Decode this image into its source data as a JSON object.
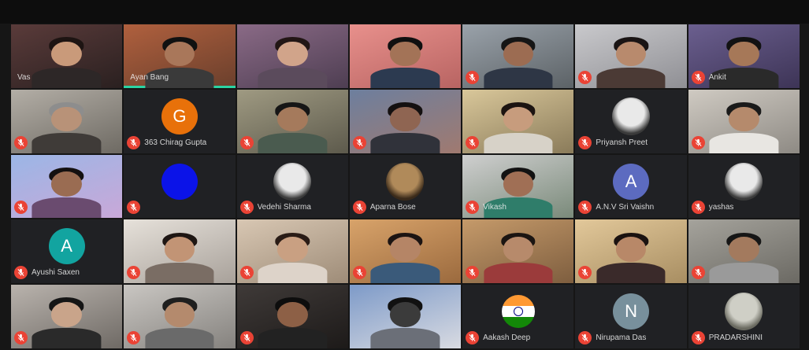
{
  "meeting": {
    "colors": {
      "background": "#161616",
      "tile": "#202124",
      "mic_muted": "#ea4335",
      "speaking": "#2bd3a3"
    },
    "participants": [
      {
        "name": "Vas",
        "type": "video",
        "muted": false,
        "speaking": false,
        "bg1": "#5a3b3a",
        "bg2": "#2a2020",
        "skin": "#c99a7a",
        "hair": "#1d1412",
        "shirt": "#2d2727"
      },
      {
        "name": "Ayan Bang",
        "type": "video",
        "muted": false,
        "speaking": true,
        "bg1": "#b0603e",
        "bg2": "#6a3f2c",
        "skin": "#a9775a",
        "hair": "#111",
        "shirt": "#3a3a3a"
      },
      {
        "name": "",
        "type": "video",
        "muted": false,
        "speaking": false,
        "bg1": "#8a6a86",
        "bg2": "#4e3e52",
        "skin": "#d1a48a",
        "hair": "#221615",
        "shirt": "#5b4b5c"
      },
      {
        "name": "",
        "type": "video",
        "muted": false,
        "speaking": false,
        "bg1": "#e8908c",
        "bg2": "#b86462",
        "skin": "#a37357",
        "hair": "#101010",
        "shirt": "#2c3a50"
      },
      {
        "name": "",
        "type": "video",
        "muted": true,
        "speaking": false,
        "bg1": "#9aa2aa",
        "bg2": "#5c6266",
        "skin": "#9c6c52",
        "hair": "#151515",
        "shirt": "#2e3645"
      },
      {
        "name": "",
        "type": "video",
        "muted": true,
        "speaking": false,
        "bg1": "#c9c9cc",
        "bg2": "#8f8f94",
        "skin": "#b88a6d",
        "hair": "#1a1414",
        "shirt": "#4b3a35"
      },
      {
        "name": "Ankit",
        "type": "video",
        "muted": true,
        "speaking": false,
        "bg1": "#6b5f8f",
        "bg2": "#3d3456",
        "skin": "#a67858",
        "hair": "#121212",
        "shirt": "#2a2a2a"
      },
      {
        "name": "",
        "type": "video",
        "muted": true,
        "speaking": false,
        "bg1": "#b3aea6",
        "bg2": "#6e6a63",
        "skin": "#b89278",
        "hair": "#8d8d8d",
        "shirt": "#3f3b38"
      },
      {
        "name": "363 Chirag Gupta",
        "type": "avatar",
        "initial": "G",
        "avatar_color": "#e8710a",
        "muted": true
      },
      {
        "name": "",
        "type": "video",
        "muted": true,
        "speaking": false,
        "bg1": "#9f9a82",
        "bg2": "#5d5a4c",
        "skin": "#a57a5c",
        "hair": "#161616",
        "shirt": "#4a5b4f"
      },
      {
        "name": "",
        "type": "video",
        "muted": true,
        "speaking": false,
        "bg1": "#6d7f9e",
        "bg2": "#a07a70",
        "skin": "#8f6552",
        "hair": "#141010",
        "shirt": "#30323a"
      },
      {
        "name": "",
        "type": "video",
        "muted": true,
        "speaking": false,
        "bg1": "#d9c79a",
        "bg2": "#8a7b5a",
        "skin": "#c79c7d",
        "hair": "#1c1411",
        "shirt": "#d7d2c8"
      },
      {
        "name": "Priyansh Preet",
        "type": "photo",
        "muted": true
      },
      {
        "name": "",
        "type": "video",
        "muted": true,
        "speaking": false,
        "bg1": "#cfcac2",
        "bg2": "#8e8a84",
        "skin": "#b58a6c",
        "hair": "#1a1a1a",
        "shirt": "#e8e6e2"
      },
      {
        "name": "",
        "type": "video",
        "muted": true,
        "speaking": false,
        "bg1": "#9bb6e6",
        "bg2": "#c9a8d8",
        "skin": "#9a6c52",
        "hair": "#141010",
        "shirt": "#6a4b6f"
      },
      {
        "name": "",
        "type": "avatar",
        "initial": "",
        "avatar_color": "#0b13e8",
        "muted": true
      },
      {
        "name": "Vedehi Sharma",
        "type": "photo",
        "muted": true
      },
      {
        "name": "Aparna Bose",
        "type": "photo",
        "muted": true
      },
      {
        "name": "Vikash",
        "type": "video",
        "muted": true,
        "speaking": false,
        "bg1": "#cfcfcf",
        "bg2": "#7a8a7a",
        "skin": "#a06f55",
        "hair": "#121212",
        "shirt": "#2f7d6a"
      },
      {
        "name": "A.N.V Sri Vaishn",
        "type": "avatar",
        "initial": "A",
        "avatar_color": "#5c6bc0",
        "muted": true
      },
      {
        "name": "yashas",
        "type": "photo",
        "muted": true
      },
      {
        "name": "Ayushi Saxen",
        "type": "avatar",
        "initial": "A",
        "avatar_color": "#12a4a0",
        "muted": true
      },
      {
        "name": "",
        "type": "video",
        "muted": true,
        "speaking": false,
        "bg1": "#e6e1da",
        "bg2": "#a8a19a",
        "skin": "#c29475",
        "hair": "#1e1613",
        "shirt": "#7a6d64"
      },
      {
        "name": "",
        "type": "video",
        "muted": true,
        "speaking": false,
        "bg1": "#d8c7b3",
        "bg2": "#9e8c78",
        "skin": "#c9a082",
        "hair": "#2a1c16",
        "shirt": "#ddd3c9"
      },
      {
        "name": "",
        "type": "video",
        "muted": true,
        "speaking": false,
        "bg1": "#d8a36a",
        "bg2": "#9b6a3e",
        "skin": "#b58566",
        "hair": "#1c1412",
        "shirt": "#3a5a7a"
      },
      {
        "name": "",
        "type": "video",
        "muted": true,
        "speaking": false,
        "bg1": "#c59a6a",
        "bg2": "#7e5e3f",
        "skin": "#b78a6b",
        "hair": "#1b1512",
        "shirt": "#9b3b3b"
      },
      {
        "name": "",
        "type": "video",
        "muted": true,
        "speaking": false,
        "bg1": "#e2c89a",
        "bg2": "#a88e62",
        "skin": "#b88868",
        "hair": "#1a1210",
        "shirt": "#3a2a2a"
      },
      {
        "name": "",
        "type": "video",
        "muted": true,
        "speaking": false,
        "bg1": "#a5a39c",
        "bg2": "#6b6963",
        "skin": "#a37a5e",
        "hair": "#161616",
        "shirt": "#9a9a9a"
      },
      {
        "name": "",
        "type": "video",
        "muted": true,
        "speaking": false,
        "bg1": "#b9b3ad",
        "bg2": "#6f6a65",
        "skin": "#c9a48a",
        "hair": "#151515",
        "shirt": "#2a2a2a"
      },
      {
        "name": "",
        "type": "video",
        "muted": true,
        "speaking": false,
        "bg1": "#c9c6c2",
        "bg2": "#85827e",
        "skin": "#b48a6d",
        "hair": "#1e1e1e",
        "shirt": "#6a6a6a"
      },
      {
        "name": "",
        "type": "video",
        "muted": true,
        "speaking": false,
        "bg1": "#3f3a38",
        "bg2": "#1d1a19",
        "skin": "#8d6046",
        "hair": "#0d0d0d",
        "shirt": "#222"
      },
      {
        "name": "",
        "type": "video",
        "muted": false,
        "speaking": false,
        "bg1": "#7d9ac8",
        "bg2": "#d9dbe2",
        "skin": "#3b3b3b",
        "hair": "#111",
        "shirt": "#6b6f78"
      },
      {
        "name": "Aakash Deep",
        "type": "flag",
        "muted": true
      },
      {
        "name": "Nirupama Das",
        "type": "avatar",
        "initial": "N",
        "avatar_color": "#78909c",
        "muted": true
      },
      {
        "name": "PRADARSHINI",
        "type": "photo",
        "muted": true
      }
    ]
  }
}
